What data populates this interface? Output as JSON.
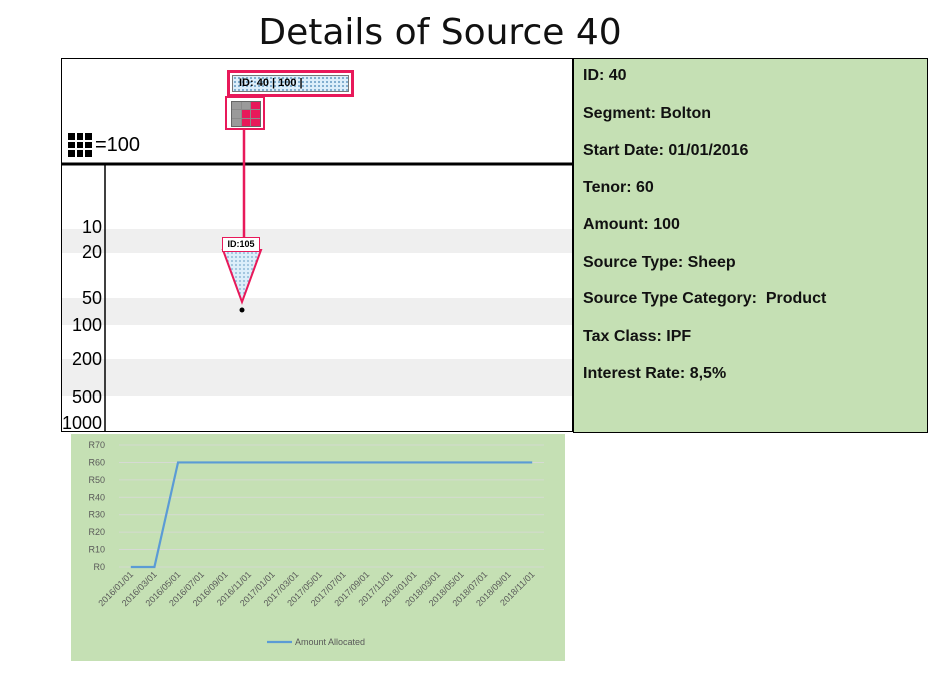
{
  "title": "Details of Source 40",
  "diagram": {
    "legend_label": "=100",
    "y_ticks": [
      "10",
      "20",
      "50",
      "100",
      "200",
      "500",
      "1000"
    ],
    "source_box_label": "ID: 40 | 100 |",
    "child_box_label": "ID:105"
  },
  "info_panel": {
    "lines": [
      "ID: 40",
      "Segment: Bolton",
      "Start Date: 01/01/2016",
      "Tenor: 60",
      "Amount: 100",
      "Source Type: Sheep",
      "Source Type Category:  Product",
      "Tax Class: IPF",
      "Interest Rate: 8,5%"
    ]
  },
  "colors": {
    "accent": "#e8195a",
    "panel_bg": "#c5e0b4",
    "series": "#5b9bd5"
  },
  "chart_data": {
    "type": "line",
    "x": [
      "2016/01/01",
      "2016/03/01",
      "2016/05/01",
      "2016/07/01",
      "2016/09/01",
      "2016/11/01",
      "2017/01/01",
      "2017/03/01",
      "2017/05/01",
      "2017/07/01",
      "2017/09/01",
      "2017/11/01",
      "2018/01/01",
      "2018/03/01",
      "2018/05/01",
      "2018/07/01",
      "2018/09/01",
      "2018/11/01"
    ],
    "x_tick_labels": [
      "2016/01/01",
      "2016/03/01",
      "2016/05/01",
      "2016/07/01",
      "2016/09/01",
      "2016/11/01",
      "2017/01/01",
      "2017/03/01",
      "2017/05/01",
      "2017/07/01",
      "2017/09/01",
      "2017/11/01",
      "2018/01/01",
      "2018/03/01",
      "2018/05/01",
      "2018/07/01",
      "2018/09/01",
      "2018/11/01"
    ],
    "series": [
      {
        "name": "Amount Allocated",
        "values": [
          0,
          0,
          60,
          60,
          60,
          60,
          60,
          60,
          60,
          60,
          60,
          60,
          60,
          60,
          60,
          60,
          60,
          60
        ]
      }
    ],
    "y_tick_labels": [
      "R0",
      "R10",
      "R20",
      "R30",
      "R40",
      "R50",
      "R60",
      "R70"
    ],
    "ylim": [
      0,
      70
    ],
    "grid": true,
    "legend": "bottom"
  }
}
